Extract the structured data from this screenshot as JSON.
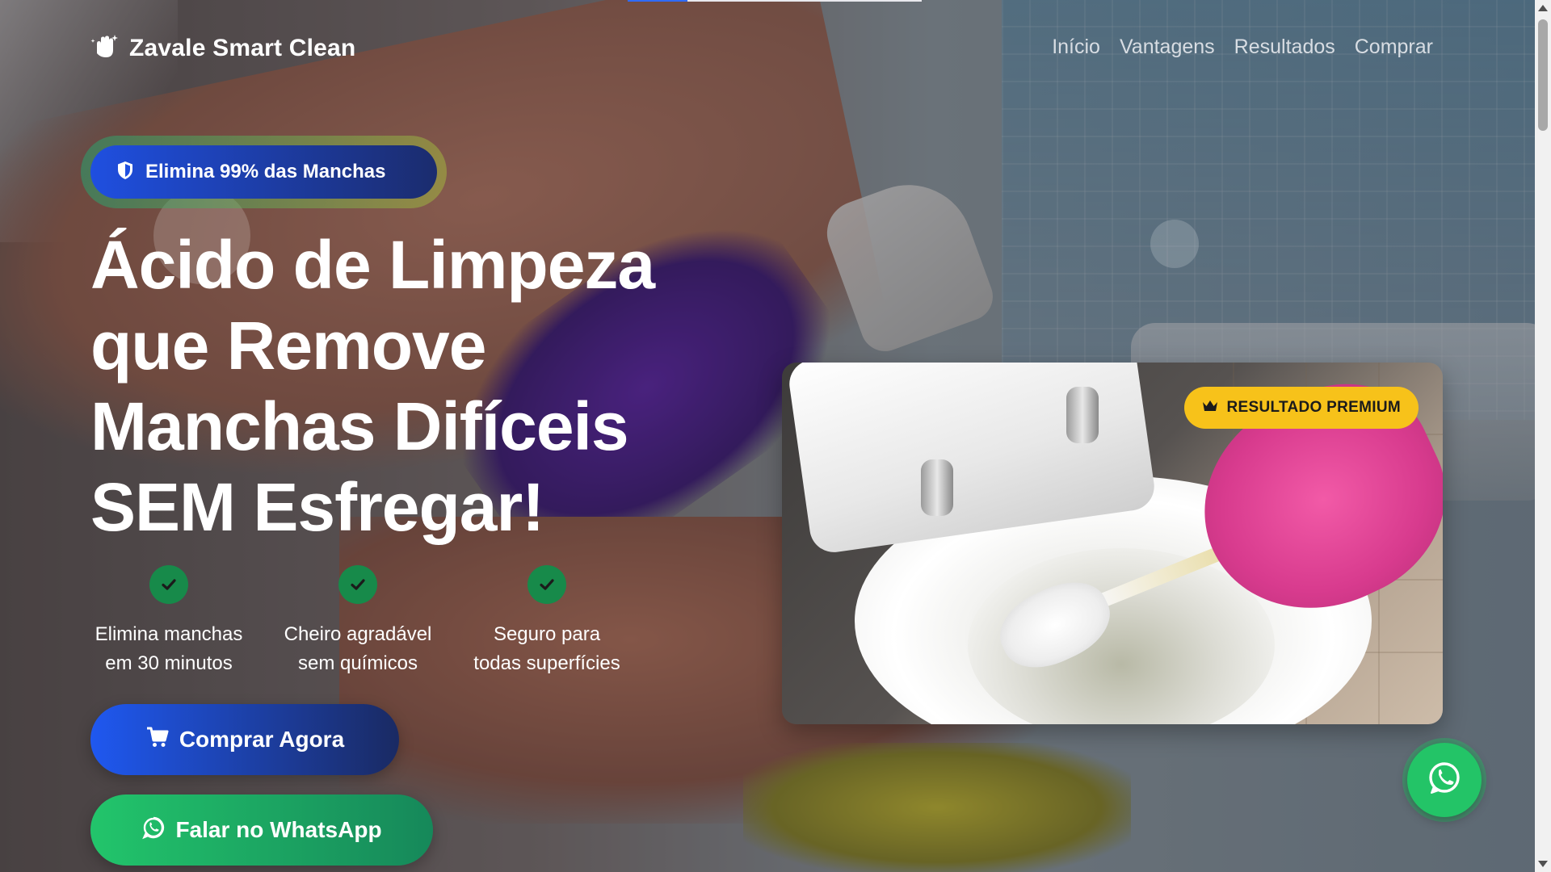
{
  "brand": {
    "name": "Zavale Smart Clean",
    "icon": "hand-sparkle-icon"
  },
  "nav": {
    "items": [
      {
        "label": "Início"
      },
      {
        "label": "Vantagens"
      },
      {
        "label": "Resultados"
      },
      {
        "label": "Comprar"
      }
    ]
  },
  "hero": {
    "badge": {
      "label": "Elimina 99% das Manchas",
      "icon": "shield-icon"
    },
    "headline_lines": [
      "Ácido de Limpeza",
      "que Remove",
      "Manchas Difíceis",
      "SEM Esfregar!"
    ],
    "features": [
      {
        "line1": "Elimina manchas",
        "line2": "em 30 minutos",
        "icon": "check-icon"
      },
      {
        "line1": "Cheiro agradável",
        "line2": "sem químicos",
        "icon": "check-icon"
      },
      {
        "line1": "Seguro para",
        "line2": "todas superfícies",
        "icon": "check-icon"
      }
    ],
    "cta_buy": {
      "label": "Comprar Agora",
      "icon": "cart-icon"
    },
    "cta_whatsapp": {
      "label": "Falar no WhatsApp",
      "icon": "whatsapp-icon"
    }
  },
  "product_card": {
    "badge": "RESULTADO PREMIUM",
    "badge_icon": "crown-icon"
  },
  "floating_whatsapp": {
    "icon": "whatsapp-icon"
  },
  "colors": {
    "primary_blue": "#1f58f0",
    "navy": "#1a2a63",
    "whatsapp_green": "#23c467",
    "check_green": "#178a4a",
    "premium_yellow": "#f7c21a"
  }
}
